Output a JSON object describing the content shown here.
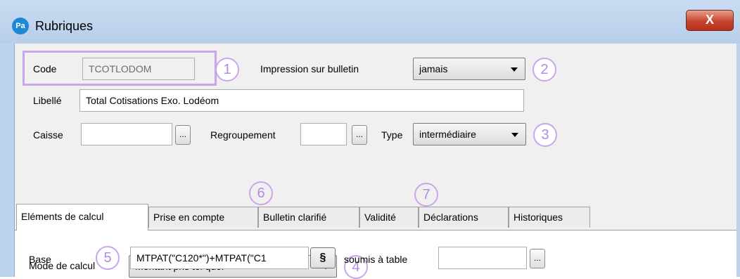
{
  "window": {
    "title": "Rubriques",
    "app_icon": "Pa",
    "close_label": "X"
  },
  "header": {
    "code_label": "Code",
    "code_value": "TCOTLODOM",
    "impression_label": "Impression sur bulletin",
    "impression_value": "jamais",
    "libelle_label": "Libellé",
    "libelle_value": "Total Cotisations Exo. Lodéom",
    "caisse_label": "Caisse",
    "caisse_value": "",
    "regroupement_label": "Regroupement",
    "regroupement_value": "",
    "type_label": "Type",
    "type_value": "intermédiaire",
    "ellipsis": "..."
  },
  "callouts": [
    "1",
    "2",
    "3",
    "4",
    "5",
    "6",
    "7"
  ],
  "tabs": [
    {
      "label": "Eléments de calcul",
      "active": true
    },
    {
      "label": "Prise en compte",
      "active": false
    },
    {
      "label": "Bulletin clarifié",
      "active": false
    },
    {
      "label": "Validité",
      "active": false
    },
    {
      "label": "Déclarations",
      "active": false
    },
    {
      "label": "Historiques",
      "active": false
    }
  ],
  "calcul": {
    "mode_label": "Mode de calcul",
    "mode_value": "Montant pris tel quel",
    "base_label": "Base",
    "base_value": "MTPAT(\"C120*\")+MTPAT(\"C1",
    "section_button": "§",
    "soumis_label": "soumis à table",
    "soumis_value": ""
  },
  "colors": {
    "callout": "#c9a6ec",
    "titlebar": "#bcd3ee",
    "close": "#c5442e"
  }
}
